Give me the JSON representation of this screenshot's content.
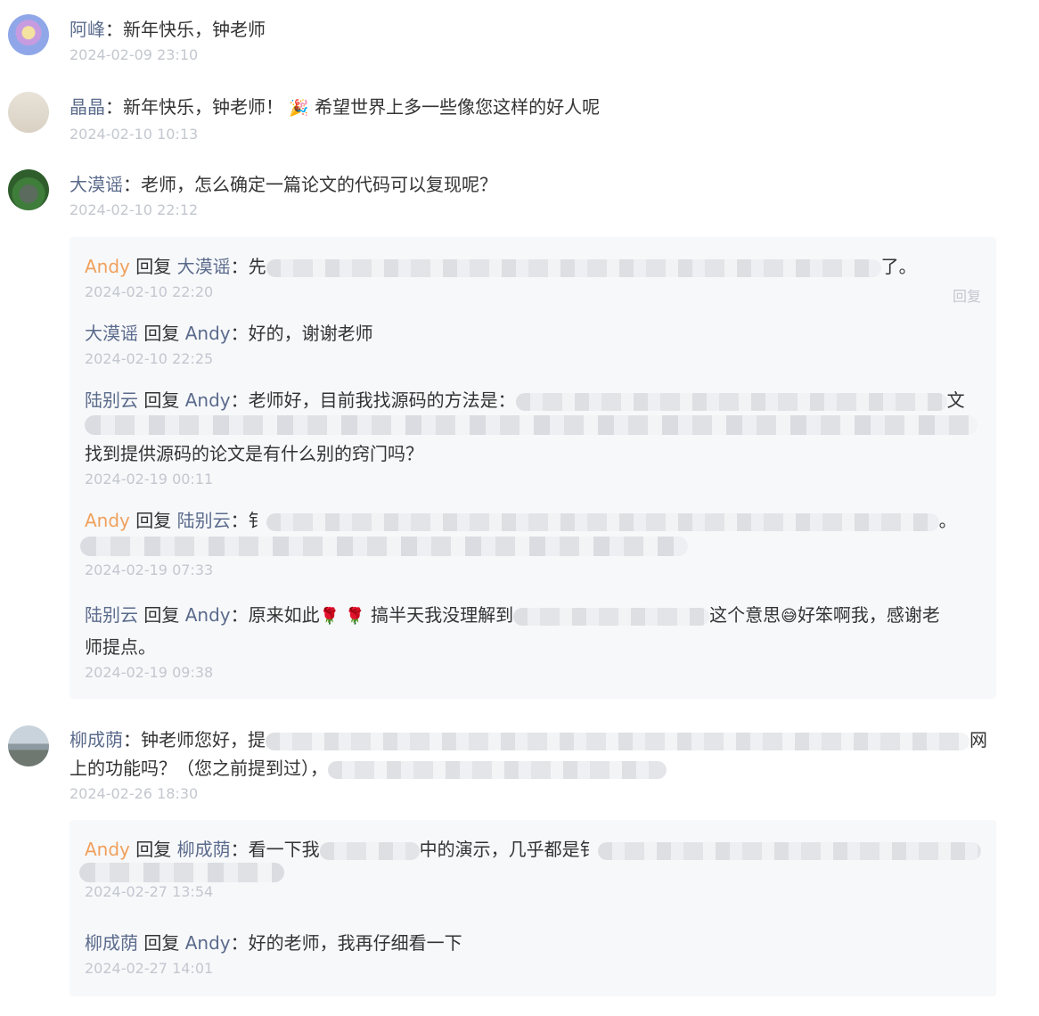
{
  "comments": [
    {
      "user": "阿峰",
      "sep": "：",
      "text": "新年快乐，钟老师",
      "time": "2024-02-09 23:10"
    },
    {
      "user": "晶晶",
      "sep": "：",
      "text": "新年快乐，钟老师！",
      "emoji": "🎉",
      "text2": " 希望世界上多一些像您这样的好人呢",
      "time": "2024-02-10 10:13"
    },
    {
      "user": "大漠谣",
      "sep": "：",
      "text": "老师，怎么确定一篇论文的代码可以复现呢？",
      "time": "2024-02-10 22:12",
      "replies": [
        {
          "from": "Andy",
          "reply_word": " 回复 ",
          "to": "大漠谣",
          "sep": "：",
          "prefix": "先",
          "suffix": "了。",
          "time": "2024-02-10 22:20",
          "reply_btn": "回复"
        },
        {
          "from": "大漠谣",
          "reply_word": " 回复 ",
          "to": "Andy",
          "sep": "：",
          "text": "好的，谢谢老师",
          "time": "2024-02-10 22:25"
        },
        {
          "from": "陆别云",
          "reply_word": " 回复 ",
          "to": "Andy",
          "sep": "：",
          "text": "老师好，目前我找源码的方法是：",
          "tail1": "文",
          "text_line3": "找到提供源码的论文是有什么别的窍门吗？",
          "time": "2024-02-19 00:11"
        },
        {
          "from": "Andy",
          "reply_word": " 回复 ",
          "to": "陆别云",
          "sep": "：",
          "prefix": "钅",
          "suffix": "。",
          "time": "2024-02-19 07:33"
        },
        {
          "from": "陆别云",
          "reply_word": " 回复 ",
          "to": "Andy",
          "sep": "：",
          "text": "原来如此",
          "emoji1": "🌹",
          "emoji2": "🌹",
          "text_b": "搞半天我没理解到",
          "text_c": "这个意思",
          "emoji3": "😅",
          "text_d": "好笨啊我，感谢老",
          "text_line2": "师提点。",
          "time": "2024-02-19 09:38"
        }
      ]
    },
    {
      "user": "柳成荫",
      "sep": "：",
      "text": "钟老师您好，提",
      "tail1": "网",
      "text_line2": "上的功能吗？（您之前提到过），",
      "time": "2024-02-26 18:30",
      "replies": [
        {
          "from": "Andy",
          "reply_word": " 回复 ",
          "to": "柳成荫",
          "sep": "：",
          "text_a": "看一下我",
          "text_b": "中的演示，几乎都是钅",
          "time": "2024-02-27 13:54"
        },
        {
          "from": "柳成荫",
          "reply_word": " 回复 ",
          "to": "Andy",
          "sep": "：",
          "text": "好的老师，我再仔细看一下",
          "time": "2024-02-27 14:01"
        }
      ]
    }
  ]
}
